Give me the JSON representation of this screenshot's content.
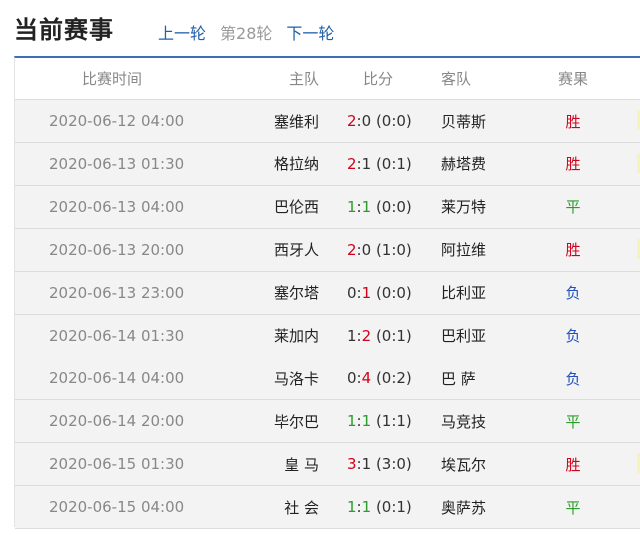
{
  "header": {
    "title": "当前赛事",
    "prev": "上一轮",
    "current": "第28轮",
    "next": "下一轮"
  },
  "table": {
    "columns": [
      "比赛时间",
      "主队",
      "比分",
      "客队",
      "赛果"
    ],
    "rows": [
      {
        "time": "2020-06-12 04:00",
        "home": "塞维利",
        "sh": "2",
        "sa": "0",
        "half": "(0:0)",
        "away": "贝蒂斯",
        "result": "胜",
        "result_color": "#d0021b"
      },
      {
        "time": "2020-06-13 01:30",
        "home": "格拉纳",
        "sh": "2",
        "sa": "1",
        "half": "(0:1)",
        "away": "赫塔费",
        "result": "胜",
        "result_color": "#d0021b"
      },
      {
        "time": "2020-06-13 04:00",
        "home": "巴伦西",
        "sh": "1",
        "sa": "1",
        "half": "(0:0)",
        "away": "莱万特",
        "result": "平",
        "result_color": "#2a9d2a"
      },
      {
        "time": "2020-06-13 20:00",
        "home": "西牙人",
        "sh": "2",
        "sa": "0",
        "half": "(1:0)",
        "away": "阿拉维",
        "result": "胜",
        "result_color": "#d0021b"
      },
      {
        "time": "2020-06-13 23:00",
        "home": "塞尔塔",
        "sh": "0",
        "sa": "1",
        "half": "(0:0)",
        "away": "比利亚",
        "result": "负",
        "result_color": "#1f4fbf"
      },
      {
        "time": "2020-06-14 01:30",
        "home": "莱加内",
        "sh": "1",
        "sa": "2",
        "half": "(0:1)",
        "away": "巴利亚",
        "result": "负",
        "result_color": "#1f4fbf"
      },
      {
        "time": "2020-06-14 04:00",
        "home": "马洛卡",
        "sh": "0",
        "sa": "4",
        "half": "(0:2)",
        "away": "巴 萨",
        "result": "负",
        "result_color": "#1f4fbf"
      },
      {
        "time": "2020-06-14 20:00",
        "home": "毕尔巴",
        "sh": "1",
        "sa": "1",
        "half": "(1:1)",
        "away": "马竞技",
        "result": "平",
        "result_color": "#2a9d2a"
      },
      {
        "time": "2020-06-15 01:30",
        "home": "皇 马",
        "sh": "3",
        "sa": "1",
        "half": "(3:0)",
        "away": "埃瓦尔",
        "result": "胜",
        "result_color": "#d0021b"
      },
      {
        "time": "2020-06-15 04:00",
        "home": "社 会",
        "sh": "1",
        "sa": "1",
        "half": "(0:1)",
        "away": "奥萨苏",
        "result": "平",
        "result_color": "#2a9d2a"
      }
    ]
  }
}
